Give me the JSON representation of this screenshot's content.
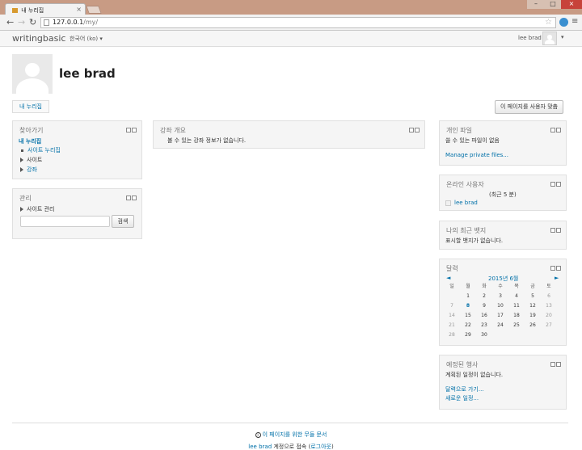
{
  "browser": {
    "tab_title": "내 누리집",
    "url_host": "127.0.0.1",
    "url_path": "/my/"
  },
  "navbar": {
    "brand": "writingbasic",
    "language": "한국어 (ko) ▾",
    "user": "lee brad",
    "caret": "▾"
  },
  "header": {
    "title": "lee brad",
    "breadcrumb": "내 누리집",
    "customise_button": "이 페이지를 사용자 맞춤"
  },
  "navigation_block": {
    "title": "찾아가기",
    "home": "내 누리집",
    "site_home": "사이트 누리집",
    "site": "사이트",
    "courses": "강좌"
  },
  "admin_block": {
    "title": "관리",
    "site_admin": "사이트 관리",
    "search_button": "검색"
  },
  "course_overview": {
    "title": "강좌 개요",
    "empty": "볼 수 있는 강좌 정보가 없습니다."
  },
  "private_files": {
    "title": "개인 파일",
    "empty": "쓸 수 있는 파일이 없음",
    "manage_link": "Manage private files..."
  },
  "online_users": {
    "title": "온라인 사용자",
    "period": "(최근 5 분)",
    "user": "lee brad"
  },
  "badges": {
    "title": "나의 최근 뱃지",
    "empty": "표시할 뱃지가 없습니다."
  },
  "calendar": {
    "title": "달력",
    "prev": "◄",
    "next": "►",
    "month": "2015년 6월",
    "weekdays": [
      "일",
      "월",
      "화",
      "수",
      "목",
      "금",
      "토"
    ],
    "weeks": [
      [
        "",
        "1",
        "2",
        "3",
        "4",
        "5",
        "6"
      ],
      [
        "7",
        "8",
        "9",
        "10",
        "11",
        "12",
        "13"
      ],
      [
        "14",
        "15",
        "16",
        "17",
        "18",
        "19",
        "20"
      ],
      [
        "21",
        "22",
        "23",
        "24",
        "25",
        "26",
        "27"
      ],
      [
        "28",
        "29",
        "30",
        "",
        "",
        "",
        ""
      ]
    ],
    "today": "8"
  },
  "upcoming": {
    "title": "예정된 행사",
    "empty": "계획된 일정이 없습니다.",
    "goto_calendar": "달력으로 가기...",
    "new_event": "새로운 일정..."
  },
  "footer": {
    "help_link": "이 페이지를 위한 무들 문서",
    "login_user": "lee brad",
    "login_text": " 계정으로 접속 (",
    "logout": "로그아웃",
    "close_paren": ")"
  },
  "colors": {
    "link": "#0070a8",
    "block_bg": "#f5f5f5",
    "chrome_frame": "#c89b84"
  }
}
